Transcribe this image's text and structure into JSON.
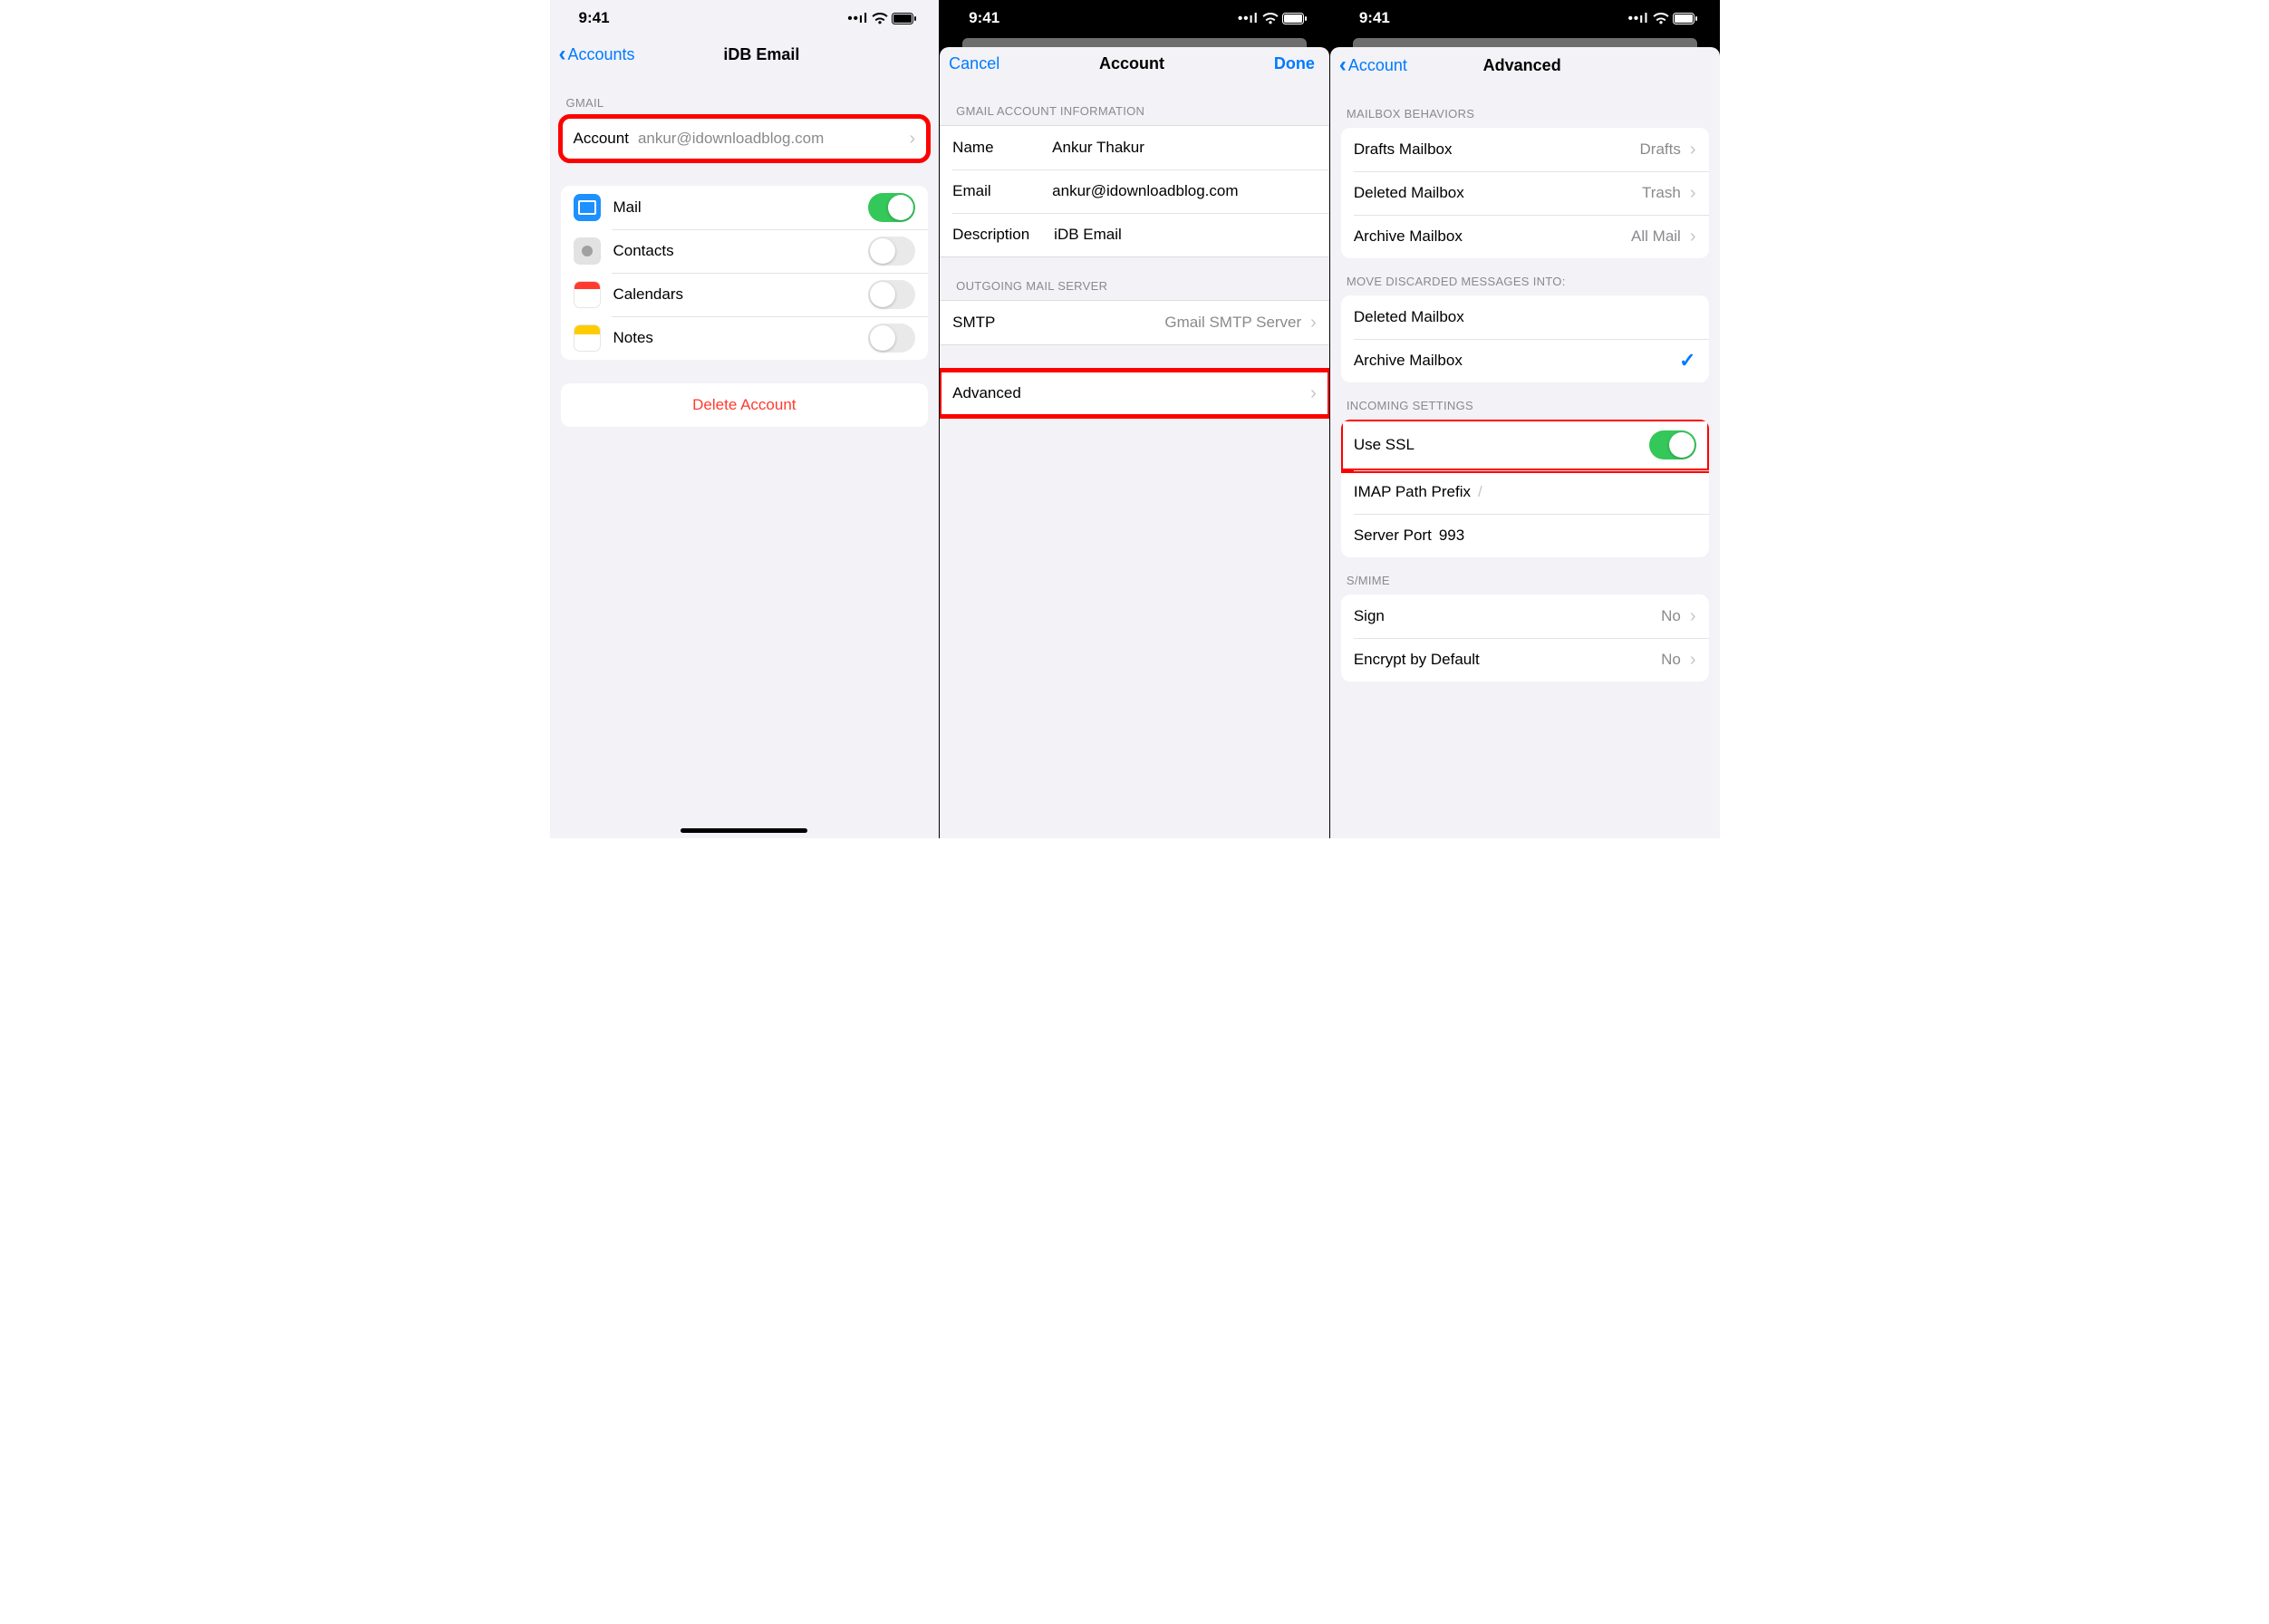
{
  "status": {
    "time": "9:41"
  },
  "phone1": {
    "nav": {
      "back": "Accounts",
      "title": "iDB Email"
    },
    "section_gmail": "GMAIL",
    "account_row": {
      "label": "Account",
      "value": "ankur@idownloadblog.com"
    },
    "apps": {
      "mail": "Mail",
      "contacts": "Contacts",
      "calendars": "Calendars",
      "notes": "Notes"
    },
    "delete": "Delete Account"
  },
  "phone2": {
    "nav": {
      "cancel": "Cancel",
      "title": "Account",
      "done": "Done"
    },
    "section_info": "GMAIL ACCOUNT INFORMATION",
    "name": {
      "label": "Name",
      "value": "Ankur Thakur"
    },
    "email": {
      "label": "Email",
      "value": "ankur@idownloadblog.com"
    },
    "desc": {
      "label": "Description",
      "value": "iDB Email"
    },
    "section_outgoing": "OUTGOING MAIL SERVER",
    "smtp": {
      "label": "SMTP",
      "value": "Gmail SMTP Server"
    },
    "advanced": "Advanced"
  },
  "phone3": {
    "nav": {
      "back": "Account",
      "title": "Advanced"
    },
    "section_behaviors": "MAILBOX BEHAVIORS",
    "drafts": {
      "label": "Drafts Mailbox",
      "value": "Drafts"
    },
    "deleted": {
      "label": "Deleted Mailbox",
      "value": "Trash"
    },
    "archive": {
      "label": "Archive Mailbox",
      "value": "All Mail"
    },
    "section_move": "MOVE DISCARDED MESSAGES INTO:",
    "move_deleted": "Deleted Mailbox",
    "move_archive": "Archive Mailbox",
    "section_incoming": "INCOMING SETTINGS",
    "ssl": "Use SSL",
    "imap_prefix": {
      "label": "IMAP Path Prefix",
      "value": "/"
    },
    "port": {
      "label": "Server Port",
      "value": "993"
    },
    "section_smime": "S/MIME",
    "sign": {
      "label": "Sign",
      "value": "No"
    },
    "encrypt": {
      "label": "Encrypt by Default",
      "value": "No"
    }
  }
}
